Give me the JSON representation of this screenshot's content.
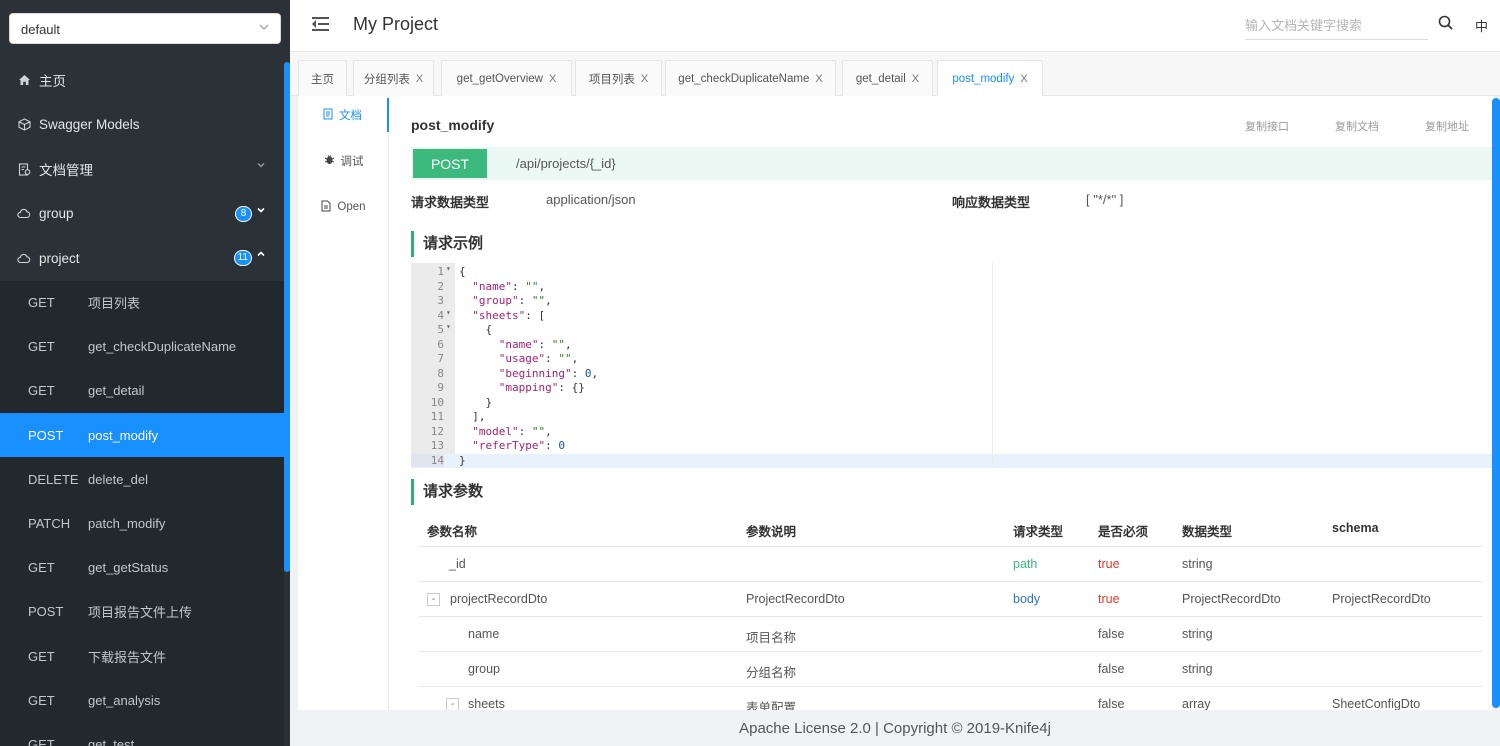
{
  "sidebar": {
    "group_select": {
      "value": "default"
    },
    "nav": [
      {
        "label": "主页",
        "icon": "home-icon"
      },
      {
        "label": "Swagger Models",
        "icon": "cube-icon"
      },
      {
        "label": "文档管理",
        "icon": "doc-manage-icon"
      },
      {
        "label": "group",
        "icon": "cloud-icon",
        "badge": "8"
      },
      {
        "label": "project",
        "icon": "cloud-icon",
        "badge": "11"
      }
    ],
    "apis": [
      {
        "method": "GET",
        "name": "项目列表"
      },
      {
        "method": "GET",
        "name": "get_checkDuplicateName"
      },
      {
        "method": "GET",
        "name": "get_detail"
      },
      {
        "method": "POST",
        "name": "post_modify",
        "active": true
      },
      {
        "method": "DELETE",
        "name": "delete_del"
      },
      {
        "method": "PATCH",
        "name": "patch_modify"
      },
      {
        "method": "GET",
        "name": "get_getStatus"
      },
      {
        "method": "POST",
        "name": "项目报告文件上传"
      },
      {
        "method": "GET",
        "name": "下载报告文件"
      },
      {
        "method": "GET",
        "name": "get_analysis"
      },
      {
        "method": "GET",
        "name": "get_test"
      }
    ]
  },
  "header": {
    "title": "My Project",
    "search_placeholder": "输入文档关键字搜索",
    "lang": "中"
  },
  "tabs": [
    {
      "label": "主页"
    },
    {
      "label": "分组列表"
    },
    {
      "label": "get_getOverview"
    },
    {
      "label": "项目列表"
    },
    {
      "label": "get_checkDuplicateName"
    },
    {
      "label": "get_detail"
    },
    {
      "label": "post_modify",
      "active": true
    }
  ],
  "tab_close": "X",
  "left_menu": [
    {
      "label": "文档",
      "active": true
    },
    {
      "label": "调试"
    },
    {
      "label": "Open"
    }
  ],
  "doc": {
    "title": "post_modify",
    "copy_api": "复制接口",
    "copy_doc": "复制文档",
    "copy_url": "复制地址",
    "method": "POST",
    "path": "/api/projects/{_id}",
    "req_type_label": "请求数据类型",
    "req_type": "application/json",
    "resp_type_label": "响应数据类型",
    "resp_type": "[ \"*/*\" ]",
    "req_example_title": "请求示例",
    "req_params_title": "请求参数"
  },
  "code_lines": [
    "{",
    "  \"name\": \"\",",
    "  \"group\": \"\",",
    "  \"sheets\": [",
    "    {",
    "      \"name\": \"\",",
    "      \"usage\": \"\",",
    "      \"beginning\": 0,",
    "      \"mapping\": {}",
    "    }",
    "  ],",
    "  \"model\": \"\",",
    "  \"referType\": 0",
    "}"
  ],
  "params": {
    "headers": [
      "参数名称",
      "参数说明",
      "请求类型",
      "是否必须",
      "数据类型",
      "schema"
    ],
    "rows": [
      {
        "name": "_id",
        "desc": "",
        "in": "path",
        "required": "true",
        "type": "string",
        "schema": ""
      },
      {
        "name": "projectRecordDto",
        "desc": "ProjectRecordDto",
        "in": "body",
        "required": "true",
        "type": "ProjectRecordDto",
        "schema": "ProjectRecordDto",
        "expand": "-"
      },
      {
        "name": "name",
        "desc": "项目名称",
        "in": "",
        "required": "false",
        "type": "string",
        "schema": ""
      },
      {
        "name": "group",
        "desc": "分组名称",
        "in": "",
        "required": "false",
        "type": "string",
        "schema": ""
      },
      {
        "name": "sheets",
        "desc": "表单配置",
        "in": "",
        "required": "false",
        "type": "array",
        "schema": "SheetConfigDto",
        "expand": "-"
      }
    ]
  },
  "footer": "Apache License 2.0 | Copyright © 2019-Knife4j"
}
